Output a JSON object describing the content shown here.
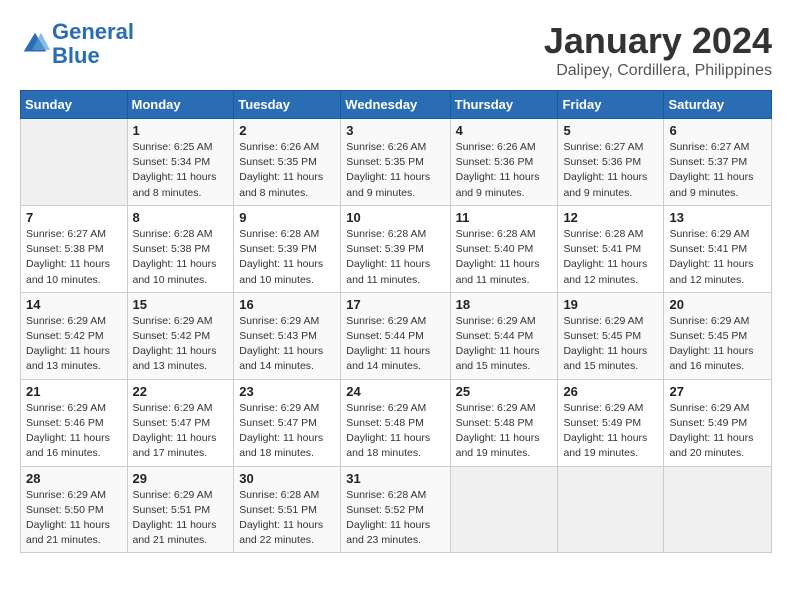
{
  "header": {
    "logo_line1": "General",
    "logo_line2": "Blue",
    "title": "January 2024",
    "subtitle": "Dalipey, Cordillera, Philippines"
  },
  "columns": [
    "Sunday",
    "Monday",
    "Tuesday",
    "Wednesday",
    "Thursday",
    "Friday",
    "Saturday"
  ],
  "weeks": [
    [
      {
        "day": "",
        "info": ""
      },
      {
        "day": "1",
        "info": "Sunrise: 6:25 AM\nSunset: 5:34 PM\nDaylight: 11 hours\nand 8 minutes."
      },
      {
        "day": "2",
        "info": "Sunrise: 6:26 AM\nSunset: 5:35 PM\nDaylight: 11 hours\nand 8 minutes."
      },
      {
        "day": "3",
        "info": "Sunrise: 6:26 AM\nSunset: 5:35 PM\nDaylight: 11 hours\nand 9 minutes."
      },
      {
        "day": "4",
        "info": "Sunrise: 6:26 AM\nSunset: 5:36 PM\nDaylight: 11 hours\nand 9 minutes."
      },
      {
        "day": "5",
        "info": "Sunrise: 6:27 AM\nSunset: 5:36 PM\nDaylight: 11 hours\nand 9 minutes."
      },
      {
        "day": "6",
        "info": "Sunrise: 6:27 AM\nSunset: 5:37 PM\nDaylight: 11 hours\nand 9 minutes."
      }
    ],
    [
      {
        "day": "7",
        "info": "Sunrise: 6:27 AM\nSunset: 5:38 PM\nDaylight: 11 hours\nand 10 minutes."
      },
      {
        "day": "8",
        "info": "Sunrise: 6:28 AM\nSunset: 5:38 PM\nDaylight: 11 hours\nand 10 minutes."
      },
      {
        "day": "9",
        "info": "Sunrise: 6:28 AM\nSunset: 5:39 PM\nDaylight: 11 hours\nand 10 minutes."
      },
      {
        "day": "10",
        "info": "Sunrise: 6:28 AM\nSunset: 5:39 PM\nDaylight: 11 hours\nand 11 minutes."
      },
      {
        "day": "11",
        "info": "Sunrise: 6:28 AM\nSunset: 5:40 PM\nDaylight: 11 hours\nand 11 minutes."
      },
      {
        "day": "12",
        "info": "Sunrise: 6:28 AM\nSunset: 5:41 PM\nDaylight: 11 hours\nand 12 minutes."
      },
      {
        "day": "13",
        "info": "Sunrise: 6:29 AM\nSunset: 5:41 PM\nDaylight: 11 hours\nand 12 minutes."
      }
    ],
    [
      {
        "day": "14",
        "info": "Sunrise: 6:29 AM\nSunset: 5:42 PM\nDaylight: 11 hours\nand 13 minutes."
      },
      {
        "day": "15",
        "info": "Sunrise: 6:29 AM\nSunset: 5:42 PM\nDaylight: 11 hours\nand 13 minutes."
      },
      {
        "day": "16",
        "info": "Sunrise: 6:29 AM\nSunset: 5:43 PM\nDaylight: 11 hours\nand 14 minutes."
      },
      {
        "day": "17",
        "info": "Sunrise: 6:29 AM\nSunset: 5:44 PM\nDaylight: 11 hours\nand 14 minutes."
      },
      {
        "day": "18",
        "info": "Sunrise: 6:29 AM\nSunset: 5:44 PM\nDaylight: 11 hours\nand 15 minutes."
      },
      {
        "day": "19",
        "info": "Sunrise: 6:29 AM\nSunset: 5:45 PM\nDaylight: 11 hours\nand 15 minutes."
      },
      {
        "day": "20",
        "info": "Sunrise: 6:29 AM\nSunset: 5:45 PM\nDaylight: 11 hours\nand 16 minutes."
      }
    ],
    [
      {
        "day": "21",
        "info": "Sunrise: 6:29 AM\nSunset: 5:46 PM\nDaylight: 11 hours\nand 16 minutes."
      },
      {
        "day": "22",
        "info": "Sunrise: 6:29 AM\nSunset: 5:47 PM\nDaylight: 11 hours\nand 17 minutes."
      },
      {
        "day": "23",
        "info": "Sunrise: 6:29 AM\nSunset: 5:47 PM\nDaylight: 11 hours\nand 18 minutes."
      },
      {
        "day": "24",
        "info": "Sunrise: 6:29 AM\nSunset: 5:48 PM\nDaylight: 11 hours\nand 18 minutes."
      },
      {
        "day": "25",
        "info": "Sunrise: 6:29 AM\nSunset: 5:48 PM\nDaylight: 11 hours\nand 19 minutes."
      },
      {
        "day": "26",
        "info": "Sunrise: 6:29 AM\nSunset: 5:49 PM\nDaylight: 11 hours\nand 19 minutes."
      },
      {
        "day": "27",
        "info": "Sunrise: 6:29 AM\nSunset: 5:49 PM\nDaylight: 11 hours\nand 20 minutes."
      }
    ],
    [
      {
        "day": "28",
        "info": "Sunrise: 6:29 AM\nSunset: 5:50 PM\nDaylight: 11 hours\nand 21 minutes."
      },
      {
        "day": "29",
        "info": "Sunrise: 6:29 AM\nSunset: 5:51 PM\nDaylight: 11 hours\nand 21 minutes."
      },
      {
        "day": "30",
        "info": "Sunrise: 6:28 AM\nSunset: 5:51 PM\nDaylight: 11 hours\nand 22 minutes."
      },
      {
        "day": "31",
        "info": "Sunrise: 6:28 AM\nSunset: 5:52 PM\nDaylight: 11 hours\nand 23 minutes."
      },
      {
        "day": "",
        "info": ""
      },
      {
        "day": "",
        "info": ""
      },
      {
        "day": "",
        "info": ""
      }
    ]
  ]
}
